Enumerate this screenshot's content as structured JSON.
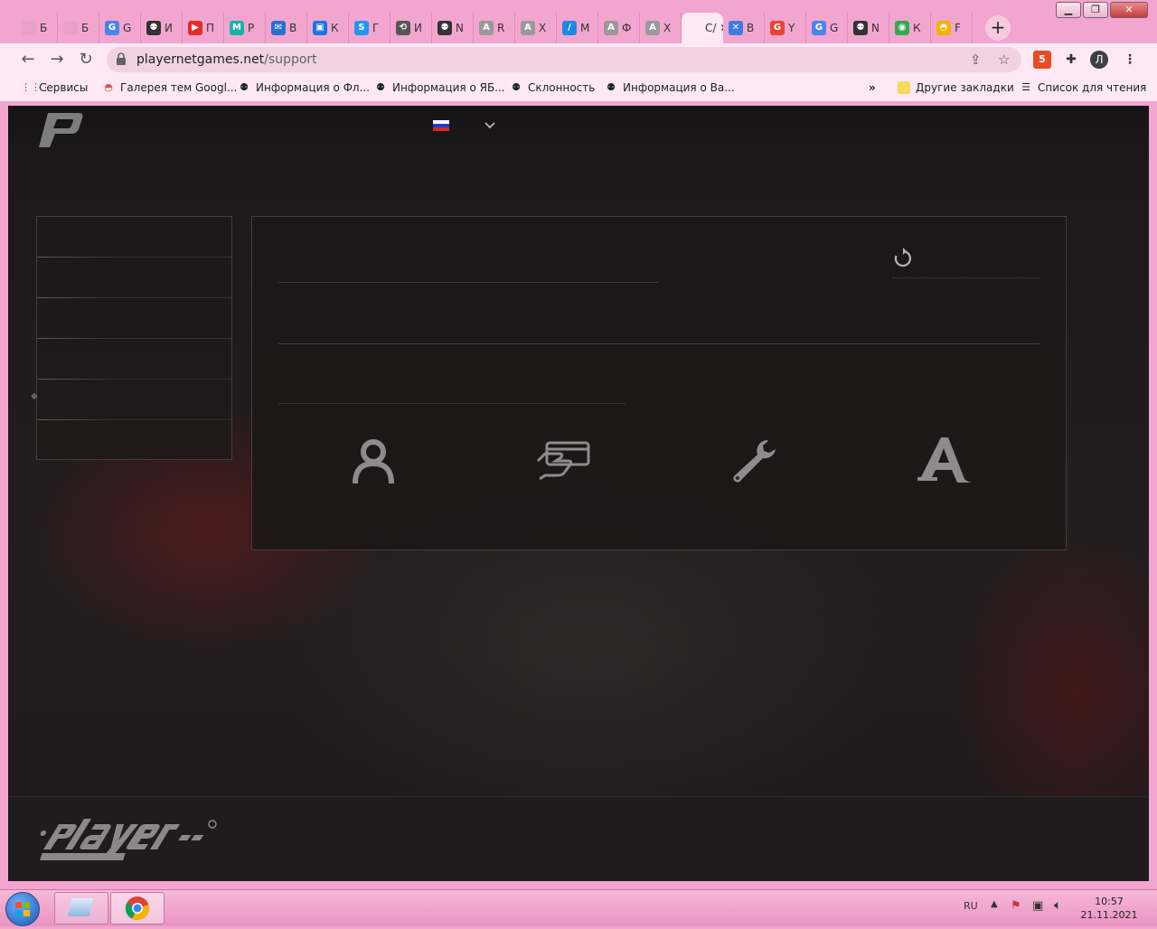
{
  "tabs": [
    {
      "label": "Б",
      "fav": "#e8a0c8",
      "glyph": ""
    },
    {
      "label": "Б",
      "fav": "#e8a0c8",
      "glyph": ""
    },
    {
      "label": "G",
      "fav": "#4a84e8",
      "glyph": "G"
    },
    {
      "label": "И",
      "fav": "#333",
      "glyph": "⚉"
    },
    {
      "label": "П",
      "fav": "#e52d27",
      "glyph": "▶"
    },
    {
      "label": "Р",
      "fav": "#16b3a8",
      "glyph": "M"
    },
    {
      "label": "В",
      "fav": "#2a6fd6",
      "glyph": "✉"
    },
    {
      "label": "К",
      "fav": "#1a73e8",
      "glyph": "▣"
    },
    {
      "label": "Г",
      "fav": "#2196f3",
      "glyph": "S"
    },
    {
      "label": "И",
      "fav": "#555",
      "glyph": "⟲"
    },
    {
      "label": "N",
      "fav": "#333",
      "glyph": "⚉"
    },
    {
      "label": "R",
      "fav": "#999",
      "glyph": "A"
    },
    {
      "label": "Х",
      "fav": "#999",
      "glyph": "A"
    },
    {
      "label": "М",
      "fav": "#1e88e5",
      "glyph": "/"
    },
    {
      "label": "Ф",
      "fav": "#999",
      "glyph": "A"
    },
    {
      "label": "Х",
      "fav": "#999",
      "glyph": "A"
    },
    {
      "label": "С/",
      "fav": "#fde8f3",
      "glyph": "",
      "active": true
    },
    {
      "label": "В",
      "fav": "#3d7be0",
      "glyph": "✕"
    },
    {
      "label": "Y",
      "fav": "#ea4335",
      "glyph": "G"
    },
    {
      "label": "G",
      "fav": "#4a84e8",
      "glyph": "G"
    },
    {
      "label": "N",
      "fav": "#333",
      "glyph": "⚉"
    },
    {
      "label": "К",
      "fav": "#34a853",
      "glyph": "◉"
    },
    {
      "label": "F",
      "fav": "#f4b400",
      "glyph": "◓"
    }
  ],
  "address": {
    "domain": "playernetgames.net",
    "path": "/support"
  },
  "profile_initial": "Л",
  "bookmarks": {
    "apps": "Сервисы",
    "items": [
      "Галерея тем Googl...",
      "Информация о Фл...",
      "Информация о ЯБ...",
      "Склонность",
      "Информация о Ва..."
    ],
    "more": "»",
    "other": "Другие закладки",
    "reading": "Список для чтения"
  },
  "site": {
    "language": "ru",
    "flag_colors": [
      "#ffffff",
      "#1c3fcf",
      "#d52b1e"
    ],
    "categories": [
      {
        "name": "account",
        "icon": "person-icon"
      },
      {
        "name": "payment",
        "icon": "payment-card-icon"
      },
      {
        "name": "technical",
        "icon": "wrench-icon"
      },
      {
        "name": "game",
        "icon": "game-logo-icon"
      }
    ]
  },
  "taskbar": {
    "lang": "RU",
    "time": "10:57",
    "date": "21.11.2021"
  }
}
